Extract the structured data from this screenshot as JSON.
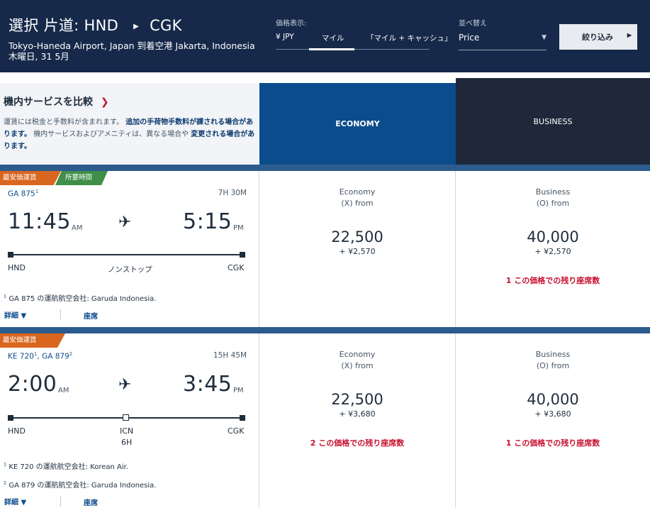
{
  "header": {
    "select_label": "選択 片道:",
    "origin": "HND",
    "destination": "CGK",
    "airports": "Tokyo-Haneda Airport, Japan 到着空港 Jakarta, Indonesia",
    "date": "木曜日, 31 5月",
    "display_label": "価格表示:",
    "display_tabs": [
      "¥ JPY",
      "マイル",
      "「マイル + キャッシュ」"
    ],
    "display_active_tab": "マイル",
    "sort_label": "並べ替え",
    "sort_value": "Price",
    "filter_button": "絞り込み"
  },
  "compare": {
    "title": "機内サービスを比較",
    "note_plain_1": "運賃には税金と手数料が含まれます。",
    "note_bold_1": "追加の手荷物手数料が課される場合があります。",
    "note_plain_2": "機内サービスおよびアメニティは、異なる場合や",
    "note_bold_2": "変更される場合があります。",
    "economy_label": "ECONOMY",
    "business_label": "BUSINESS"
  },
  "flights": [
    {
      "tags": [
        "最安価運賃",
        "所要時間"
      ],
      "flight_number": "GA 875",
      "flight_number_sup": "1",
      "duration": "7H 30M",
      "depart_time": "11:45",
      "depart_ampm": "AM",
      "arrive_time": "5:15",
      "arrive_ampm": "PM",
      "origin": "HND",
      "destination": "CGK",
      "stops_label": "ノンストップ",
      "operator_notes": [
        {
          "sup": "1",
          "text": "GA 875 の運航航空会社: Garuda Indonesia."
        }
      ],
      "details_label": "詳細 ▼",
      "seats_label": "座席",
      "economy": {
        "cabin": "Economy",
        "class": "(X) from",
        "miles": "22,500",
        "tax": "+ ¥2,570",
        "seats_left": ""
      },
      "business": {
        "cabin": "Business",
        "class": "(O) from",
        "miles": "40,000",
        "tax": "+ ¥2,570",
        "seats_left": "1 この価格での残り座席数"
      }
    },
    {
      "tags": [
        "最安価運賃"
      ],
      "flight_number": "KE 720",
      "flight_number_sup": "1",
      "flight_number_2": "GA 879",
      "flight_number_2_sup": "2",
      "duration": "15H 45M",
      "depart_time": "2:00",
      "depart_ampm": "AM",
      "arrive_time": "3:45",
      "arrive_ampm": "PM",
      "origin": "HND",
      "connection": "ICN",
      "connection_time": "6H",
      "destination": "CGK",
      "operator_notes": [
        {
          "sup": "1",
          "text": "KE 720 の運航航空会社: Korean Air."
        },
        {
          "sup": "2",
          "text": "GA 879 の運航航空会社: Garuda Indonesia."
        }
      ],
      "details_label": "詳細 ▼",
      "seats_label": "座席",
      "economy": {
        "cabin": "Economy",
        "class": "(X) from",
        "miles": "22,500",
        "tax": "+ ¥3,680",
        "seats_left": "2 この価格での残り座席数"
      },
      "business": {
        "cabin": "Business",
        "class": "(O) from",
        "miles": "40,000",
        "tax": "+ ¥3,680",
        "seats_left": "1 この価格での残り座席数"
      }
    }
  ],
  "colors": {
    "header_bg": "#16294a",
    "economy_bg": "#0b4c8c",
    "business_bg": "#1e283a",
    "cheapest_tag": "#d9661f",
    "duration_tag": "#3f8f49",
    "alert_red": "#c8102e"
  },
  "icons": [
    "plane-icon",
    "chevron-right-icon",
    "chevron-down-icon",
    "caret-right-icon"
  ]
}
